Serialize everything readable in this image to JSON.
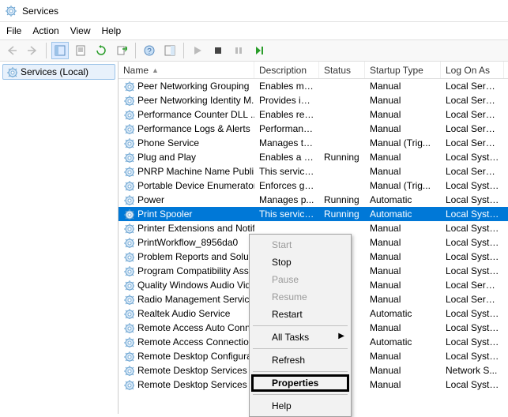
{
  "window": {
    "title": "Services"
  },
  "menu": {
    "items": [
      "File",
      "Action",
      "View",
      "Help"
    ]
  },
  "toolbar": {
    "back": "←",
    "forward": "→"
  },
  "sidebar": {
    "label": "Services (Local)"
  },
  "columns": {
    "name": "Name",
    "description": "Description",
    "status": "Status",
    "startup": "Startup Type",
    "logon": "Log On As"
  },
  "services": [
    {
      "name": "Peer Networking Grouping",
      "desc": "Enables mul...",
      "status": "",
      "startup": "Manual",
      "logon": "Local Service"
    },
    {
      "name": "Peer Networking Identity M...",
      "desc": "Provides ide...",
      "status": "",
      "startup": "Manual",
      "logon": "Local Service"
    },
    {
      "name": "Performance Counter DLL ...",
      "desc": "Enables rem...",
      "status": "",
      "startup": "Manual",
      "logon": "Local Service"
    },
    {
      "name": "Performance Logs & Alerts",
      "desc": "Performanc...",
      "status": "",
      "startup": "Manual",
      "logon": "Local Service"
    },
    {
      "name": "Phone Service",
      "desc": "Manages th...",
      "status": "",
      "startup": "Manual (Trig...",
      "logon": "Local Service"
    },
    {
      "name": "Plug and Play",
      "desc": "Enables a c...",
      "status": "Running",
      "startup": "Manual",
      "logon": "Local Syste..."
    },
    {
      "name": "PNRP Machine Name Publi...",
      "desc": "This service ...",
      "status": "",
      "startup": "Manual",
      "logon": "Local Service"
    },
    {
      "name": "Portable Device Enumerator...",
      "desc": "Enforces gr...",
      "status": "",
      "startup": "Manual (Trig...",
      "logon": "Local Syste..."
    },
    {
      "name": "Power",
      "desc": "Manages p...",
      "status": "Running",
      "startup": "Automatic",
      "logon": "Local Syste..."
    },
    {
      "name": "Print Spooler",
      "desc": "This service ...",
      "status": "Running",
      "startup": "Automatic",
      "logon": "Local Syste...",
      "selected": true
    },
    {
      "name": "Printer Extensions and Notif...",
      "desc": "",
      "status": "",
      "startup": "Manual",
      "logon": "Local Syste..."
    },
    {
      "name": "PrintWorkflow_8956da0",
      "desc": "",
      "status": "",
      "startup": "Manual",
      "logon": "Local Syste..."
    },
    {
      "name": "Problem Reports and Soluti...",
      "desc": "",
      "status": "",
      "startup": "Manual",
      "logon": "Local Syste..."
    },
    {
      "name": "Program Compatibility Assi...",
      "desc": "",
      "status": "",
      "startup": "Manual",
      "logon": "Local Syste..."
    },
    {
      "name": "Quality Windows Audio Vid...",
      "desc": "",
      "status": "",
      "startup": "Manual",
      "logon": "Local Service"
    },
    {
      "name": "Radio Management Service",
      "desc": "",
      "status": "",
      "startup": "Manual",
      "logon": "Local Service"
    },
    {
      "name": "Realtek Audio Service",
      "desc": "",
      "status": "",
      "startup": "Automatic",
      "logon": "Local Syste..."
    },
    {
      "name": "Remote Access Auto Conne...",
      "desc": "",
      "status": "",
      "startup": "Manual",
      "logon": "Local Syste..."
    },
    {
      "name": "Remote Access Connection...",
      "desc": "",
      "status": "",
      "startup": "Automatic",
      "logon": "Local Syste..."
    },
    {
      "name": "Remote Desktop Configurat...",
      "desc": "",
      "status": "",
      "startup": "Manual",
      "logon": "Local Syste..."
    },
    {
      "name": "Remote Desktop Services",
      "desc": "",
      "status": "",
      "startup": "Manual",
      "logon": "Network S..."
    },
    {
      "name": "Remote Desktop Services U...",
      "desc": "",
      "status": "",
      "startup": "Manual",
      "logon": "Local Syste..."
    }
  ],
  "contextMenu": {
    "start": "Start",
    "stop": "Stop",
    "pause": "Pause",
    "resume": "Resume",
    "restart": "Restart",
    "allTasks": "All Tasks",
    "refresh": "Refresh",
    "properties": "Properties",
    "help": "Help"
  }
}
